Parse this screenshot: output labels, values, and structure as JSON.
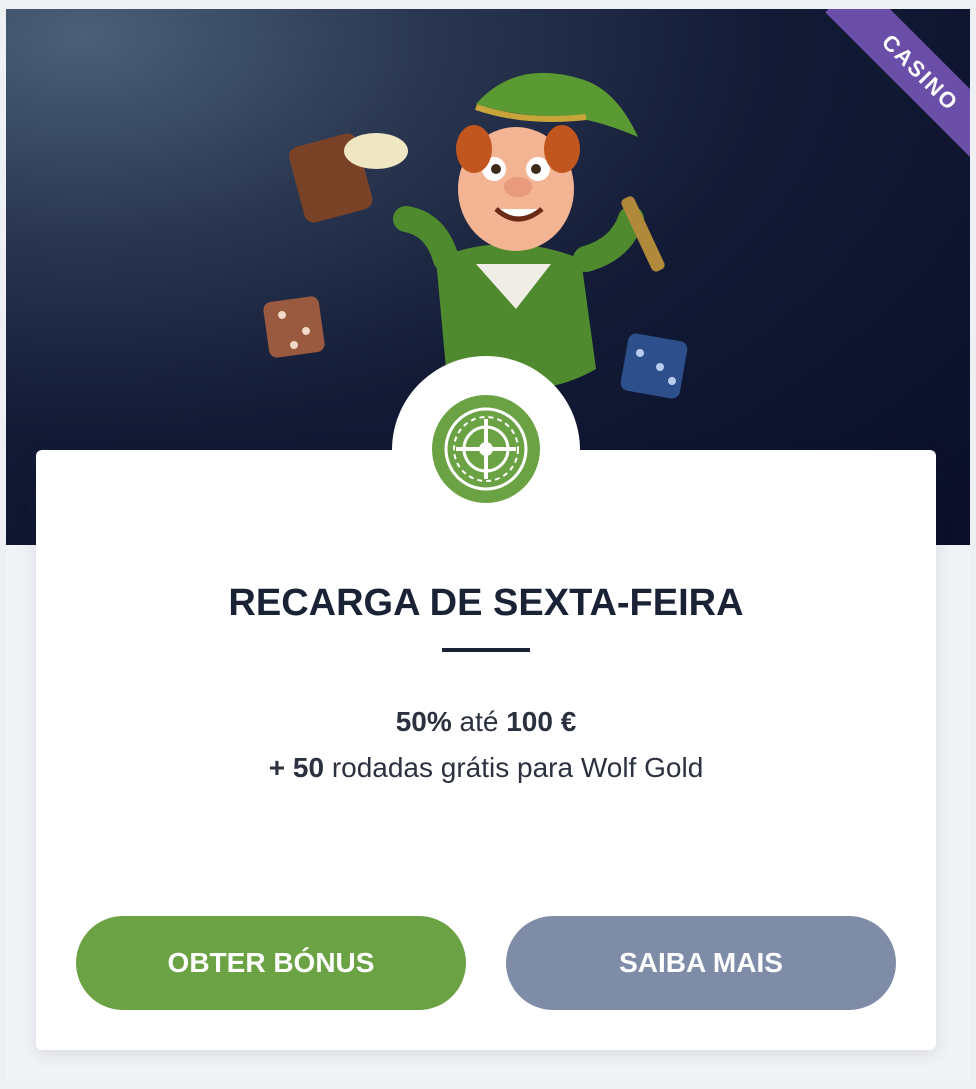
{
  "colors": {
    "accent_green": "#6aa244",
    "secondary_button": "#7f8ca8",
    "ribbon_purple": "#6b4ea8",
    "title_color": "#1a2235"
  },
  "ribbon": {
    "label": "CASINO"
  },
  "hero": {
    "icon": "leprechaun-illustration"
  },
  "badge": {
    "icon": "roulette-icon"
  },
  "card": {
    "title": "RECARGA DE SEXTA-FEIRA",
    "offer": {
      "percent": "50%",
      "up_to_word": "até",
      "amount": "100 €",
      "plus": "+",
      "spins": "50",
      "spins_text": "rodadas grátis para Wolf Gold"
    }
  },
  "buttons": {
    "primary_label": "OBTER BÓNUS",
    "secondary_label": "SAIBA MAIS"
  }
}
